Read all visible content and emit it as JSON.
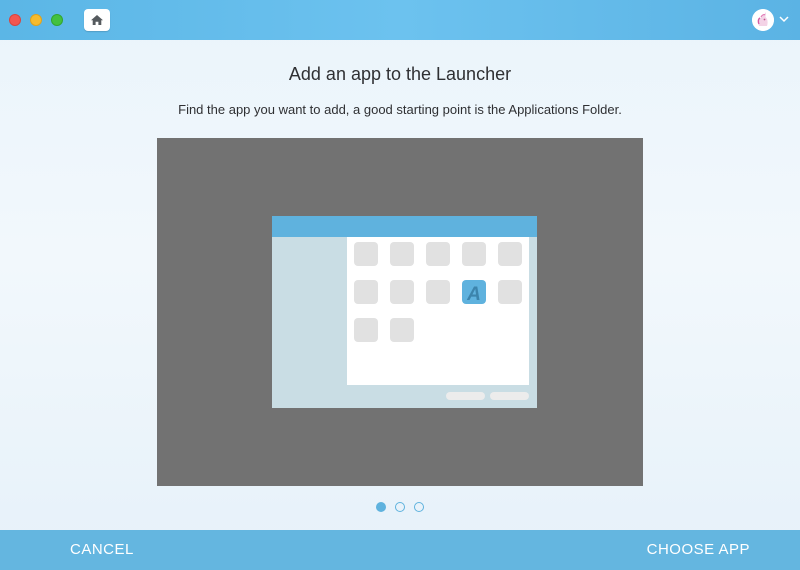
{
  "titlebar": {
    "home_icon": "home-icon",
    "avatar_icon": "unicorn-avatar-icon",
    "menu_icon": "chevron-down-icon"
  },
  "content": {
    "title": "Add an app to the Launcher",
    "instruction": "Find the app you want to add, a good starting point is the Applications Folder.",
    "illustration": {
      "highlighted_app_letter": "A"
    }
  },
  "pagination": {
    "total_pages": 3,
    "current_page": 1
  },
  "footer": {
    "cancel_label": "CANCEL",
    "choose_label": "CHOOSE APP"
  },
  "colors": {
    "accent": "#64b6e0",
    "titlebar": "#6cc2ef",
    "illustration_bg": "#727272"
  }
}
